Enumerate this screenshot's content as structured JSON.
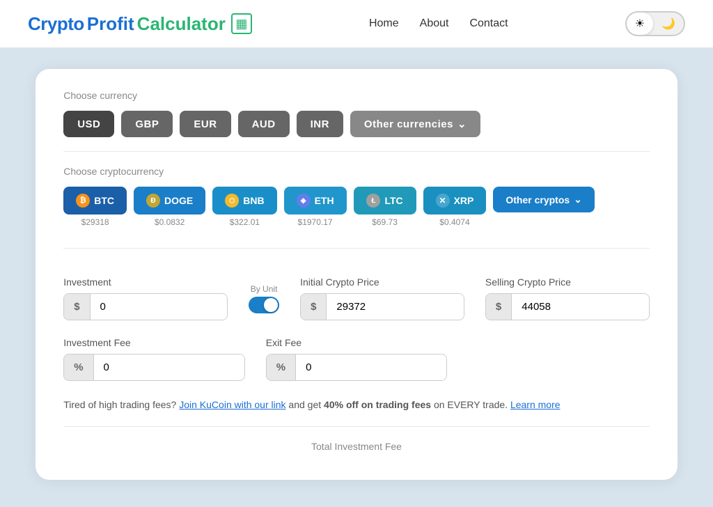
{
  "header": {
    "logo_crypto": "Crypto",
    "logo_profit": "Profit",
    "logo_calculator": "Calculator",
    "logo_icon": "▦",
    "nav": {
      "home": "Home",
      "about": "About",
      "contact": "Contact"
    },
    "theme": {
      "sun_icon": "☀",
      "moon_icon": "🌙"
    }
  },
  "currency_section": {
    "label": "Choose currency",
    "buttons": [
      {
        "id": "usd",
        "label": "USD",
        "active": true
      },
      {
        "id": "gbp",
        "label": "GBP",
        "active": false
      },
      {
        "id": "eur",
        "label": "EUR",
        "active": false
      },
      {
        "id": "aud",
        "label": "AUD",
        "active": false
      },
      {
        "id": "inr",
        "label": "INR",
        "active": false
      },
      {
        "id": "other",
        "label": "Other currencies",
        "active": false,
        "icon": "⌄"
      }
    ]
  },
  "crypto_section": {
    "label": "Choose cryptocurrency",
    "cryptos": [
      {
        "id": "btc",
        "label": "BTC",
        "price": "$29318",
        "icon": "₿",
        "icon_class": "btc-icon",
        "btn_class": "btc"
      },
      {
        "id": "doge",
        "label": "DOGE",
        "price": "$0.0832",
        "icon": "Ð",
        "icon_class": "doge-icon",
        "btn_class": "doge"
      },
      {
        "id": "bnb",
        "label": "BNB",
        "price": "$322.01",
        "icon": "⬡",
        "icon_class": "bnb-icon",
        "btn_class": "bnb"
      },
      {
        "id": "eth",
        "label": "ETH",
        "price": "$1970.17",
        "icon": "◆",
        "icon_class": "eth-icon",
        "btn_class": "eth"
      },
      {
        "id": "ltc",
        "label": "LTC",
        "price": "$69.73",
        "icon": "Ł",
        "icon_class": "ltc-icon",
        "btn_class": "ltc"
      },
      {
        "id": "xrp",
        "label": "XRP",
        "price": "$0.4074",
        "icon": "✕",
        "icon_class": "xrp-icon",
        "btn_class": "xrp"
      }
    ],
    "other_label": "Other cryptos",
    "other_icon": "⌄"
  },
  "form": {
    "by_unit_label": "By Unit",
    "investment_label": "Investment",
    "investment_prefix": "$",
    "investment_value": "0",
    "initial_price_label": "Initial Crypto Price",
    "initial_price_prefix": "$",
    "initial_price_value": "29372",
    "selling_price_label": "Selling Crypto Price",
    "selling_price_prefix": "$",
    "selling_price_value": "44058",
    "investment_fee_label": "Investment Fee",
    "investment_fee_prefix": "%",
    "investment_fee_value": "0",
    "exit_fee_label": "Exit Fee",
    "exit_fee_prefix": "%",
    "exit_fee_value": "0"
  },
  "promo": {
    "text_before": "Tired of high trading fees?",
    "link_text": "Join KuCoin with our link",
    "text_middle": "and get",
    "highlight": "40% off on trading fees",
    "text_after": "on EVERY trade.",
    "learn_more": "Learn more"
  },
  "total_fee": {
    "label": "Total Investment Fee"
  }
}
